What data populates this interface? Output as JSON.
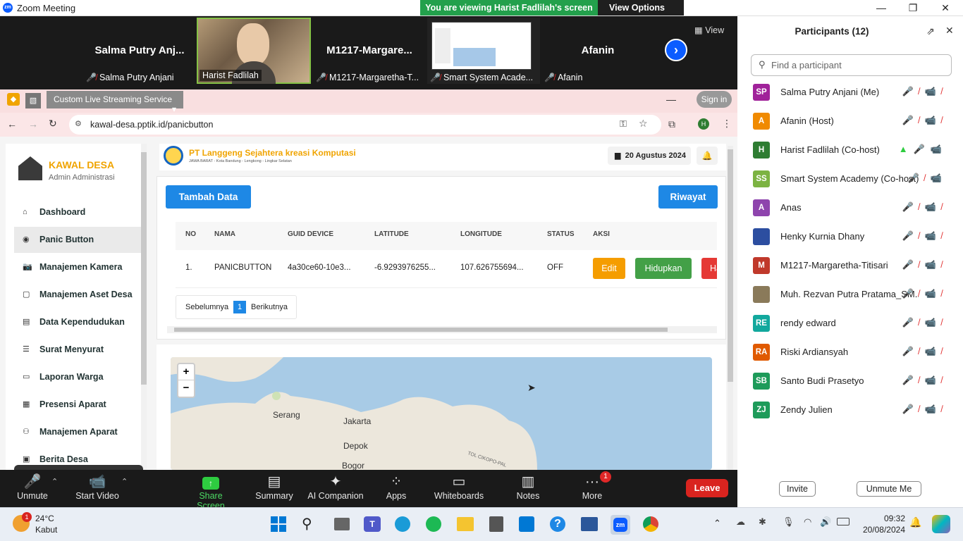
{
  "zoom": {
    "app_title": "Zoom Meeting",
    "banner_text": "You are viewing Harist Fadlilah's screen",
    "view_options": "View Options",
    "view_button": "View",
    "tiles": [
      {
        "big": "Salma  Putry  Anj...",
        "label": "Salma Putry Anjani"
      },
      {
        "big": "",
        "label": "Harist Fadlilah"
      },
      {
        "big": "M1217-Margare...",
        "label": "M1217-Margaretha-T..."
      },
      {
        "big": "",
        "label": "Smart System Acade..."
      },
      {
        "big": "Afanin",
        "label": "Afanin"
      }
    ],
    "controls": {
      "unmute": "Unmute",
      "start_video": "Start Video",
      "share": "Share Screen",
      "summary": "Summary",
      "ai": "AI Companion",
      "apps": "Apps",
      "whiteboards": "Whiteboards",
      "notes": "Notes",
      "more": "More",
      "more_badge": "1",
      "leave": "Leave"
    }
  },
  "participants": {
    "title": "Participants (12)",
    "search_placeholder": "Find a participant",
    "list": [
      {
        "initials": "SP",
        "color": "#a0229a",
        "name": "Salma Putry Anjani (Me)"
      },
      {
        "initials": "A",
        "color": "#f08a00",
        "name": "Afanin (Host)"
      },
      {
        "initials": "H",
        "color": "#2e7d32",
        "name": "Harist Fadlilah (Co-host)"
      },
      {
        "initials": "SS",
        "color": "#7cb342",
        "name": "Smart System Academy (Co-host)"
      },
      {
        "initials": "A",
        "color": "#8e44ad",
        "name": "Anas"
      },
      {
        "initials": "",
        "color": "#2c4ea0",
        "name": "Henky Kurnia Dhany"
      },
      {
        "initials": "M",
        "color": "#c0392b",
        "name": "M1217-Margaretha-Titisari"
      },
      {
        "initials": "",
        "color": "#8a7a5a",
        "name": "Muh. Rezvan Putra Pratama_SM..."
      },
      {
        "initials": "RE",
        "color": "#12a89d",
        "name": "rendy edward"
      },
      {
        "initials": "RA",
        "color": "#e05a00",
        "name": "Riski Ardiansyah"
      },
      {
        "initials": "SB",
        "color": "#1e9b5a",
        "name": "Santo Budi Prasetyo"
      },
      {
        "initials": "ZJ",
        "color": "#1e9b5a",
        "name": "Zendy Julien"
      }
    ],
    "invite": "Invite",
    "unmute_me": "Unmute Me"
  },
  "shared": {
    "tab_title": "Custom Live Streaming Service",
    "sign_in": "Sign in",
    "url": "kawal-desa.pptik.id/panicbutton",
    "profile_initial": "H",
    "brand": "KAWAL DESA",
    "brand_sub": "Admin Administrasi",
    "nav": [
      "Dashboard",
      "Panic Button",
      "Manajemen Kamera",
      "Manajemen Aset Desa",
      "Data Kependudukan",
      "Surat Menyurat",
      "Laporan Warga",
      "Presensi Aparat",
      "Manajemen Aparat",
      "Berita Desa"
    ],
    "company": "PT Langgeng Sejahtera kreasi Komputasi",
    "company_sub": "JAWA BARAT - Kota Bandung - Lengkong - Lingkar Selatan",
    "date": "20 Agustus 2024",
    "add_button": "Tambah Data",
    "history_button": "Riwayat",
    "table": {
      "headers": [
        "NO",
        "NAMA",
        "GUID DEVICE",
        "LATITUDE",
        "LONGITUDE",
        "STATUS",
        "AKSI"
      ],
      "rows": [
        {
          "no": "1.",
          "nama": "PANICBUTTON",
          "guid": "4a30ce60-10e3...",
          "lat": "-6.9293976255...",
          "lon": "107.626755694...",
          "status": "OFF"
        }
      ],
      "actions": {
        "edit": "Edit",
        "on": "Hidupkan",
        "del": "Ha"
      }
    },
    "pagination": {
      "prev": "Sebelumnya",
      "page": "1",
      "next": "Berikutnya"
    },
    "map": {
      "zoom_in": "+",
      "zoom_out": "−",
      "labels": [
        "Serang",
        "Jakarta",
        "Depok",
        "Bogor",
        "TOL CIKOPO-PAL"
      ]
    }
  },
  "taskbar": {
    "temp": "24°C",
    "weather": "Kabut",
    "weather_badge": "1",
    "time": "09:32",
    "date": "20/08/2024"
  }
}
